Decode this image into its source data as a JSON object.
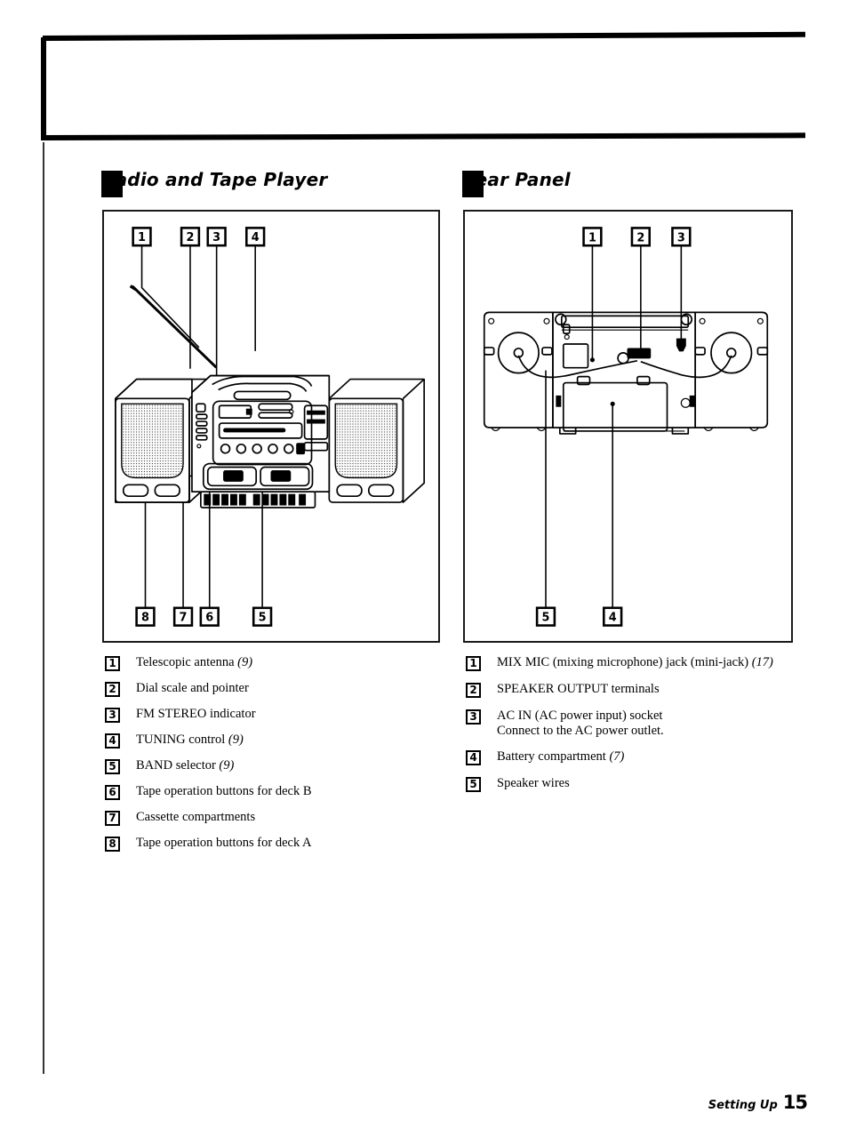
{
  "page": {
    "footer_label": "Setting Up",
    "footer_page": "15"
  },
  "sections": {
    "left": {
      "heading": "Radio and Tape Player",
      "diagram_name": "front-panel-diagram",
      "callouts_top": [
        "1",
        "2",
        "3",
        "4"
      ],
      "callouts_bottom": [
        "8",
        "7",
        "6",
        "5"
      ],
      "legend": [
        {
          "num": "1",
          "text": "Telescopic antenna ",
          "page_ref": "(9)"
        },
        {
          "num": "2",
          "text": "Dial scale and pointer",
          "page_ref": ""
        },
        {
          "num": "3",
          "text": "FM STEREO indicator",
          "page_ref": ""
        },
        {
          "num": "4",
          "text": "TUNING control ",
          "page_ref": "(9)"
        },
        {
          "num": "5",
          "text": "BAND selector ",
          "page_ref": "(9)"
        },
        {
          "num": "6",
          "text": "Tape operation buttons for deck B",
          "page_ref": ""
        },
        {
          "num": "7",
          "text": "Cassette compartments",
          "page_ref": ""
        },
        {
          "num": "8",
          "text": "Tape operation buttons for deck A",
          "page_ref": ""
        }
      ]
    },
    "right": {
      "heading": "Rear Panel",
      "diagram_name": "rear-panel-diagram",
      "callouts_top": [
        "1",
        "2",
        "3"
      ],
      "callouts_bottom": [
        "5",
        "4"
      ],
      "legend": [
        {
          "num": "1",
          "text": "MIX MIC (mixing microphone) jack (mini-jack) ",
          "page_ref": "(17)"
        },
        {
          "num": "2",
          "text": "SPEAKER OUTPUT terminals",
          "page_ref": ""
        },
        {
          "num": "3",
          "text": "AC IN (AC power input) socket",
          "page_ref": "",
          "text2": "Connect to the AC power outlet."
        },
        {
          "num": "4",
          "text": "Battery compartment ",
          "page_ref": "(7)"
        },
        {
          "num": "5",
          "text": "Speaker wires",
          "page_ref": ""
        }
      ]
    }
  },
  "colors": {
    "ink": "#000000",
    "paper": "#ffffff"
  }
}
